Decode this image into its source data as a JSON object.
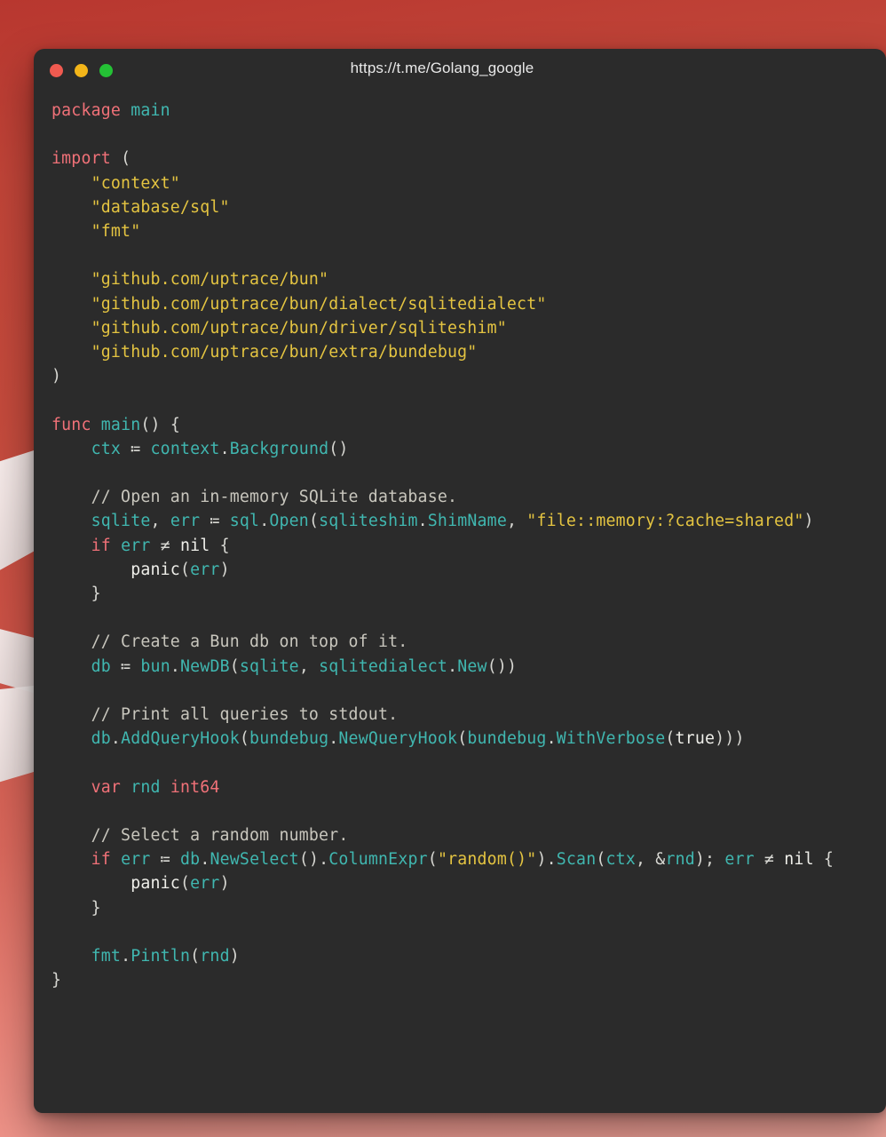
{
  "window": {
    "title": "https://t.me/Golang_google",
    "traffic_lights": [
      {
        "name": "close",
        "color": "#f05a50"
      },
      {
        "name": "minimize",
        "color": "#f3b519"
      },
      {
        "name": "maximize",
        "color": "#24c135"
      }
    ],
    "background_color": "#2b2b2b"
  },
  "backdrop": {
    "gradient_from": "#b8372f",
    "gradient_to": "#f3a79d"
  },
  "theme": {
    "keyword": "#f07178",
    "identifier": "#40b7b0",
    "string": "#e4c441",
    "comment": "#c8c6bd",
    "plain": "#d7d7d2"
  },
  "code": {
    "language": "go",
    "lines": [
      {
        "id": "l1",
        "text": "package main"
      },
      {
        "id": "l2",
        "text": ""
      },
      {
        "id": "l3",
        "text": "import ("
      },
      {
        "id": "l4",
        "text": "    \"context\""
      },
      {
        "id": "l5",
        "text": "    \"database/sql\""
      },
      {
        "id": "l6",
        "text": "    \"fmt\""
      },
      {
        "id": "l7",
        "text": ""
      },
      {
        "id": "l8",
        "text": "    \"github.com/uptrace/bun\""
      },
      {
        "id": "l9",
        "text": "    \"github.com/uptrace/bun/dialect/sqlitedialect\""
      },
      {
        "id": "l10",
        "text": "    \"github.com/uptrace/bun/driver/sqliteshim\""
      },
      {
        "id": "l11",
        "text": "    \"github.com/uptrace/bun/extra/bundebug\""
      },
      {
        "id": "l12",
        "text": ")"
      },
      {
        "id": "l13",
        "text": ""
      },
      {
        "id": "l14",
        "text": "func main() {"
      },
      {
        "id": "l15",
        "text": "    ctx := context.Background()"
      },
      {
        "id": "l16",
        "text": ""
      },
      {
        "id": "l17",
        "text": "    // Open an in-memory SQLite database."
      },
      {
        "id": "l18",
        "text": "    sqlite, err := sql.Open(sqliteshim.ShimName, \"file::memory:?cache=shared\")"
      },
      {
        "id": "l19",
        "text": "    if err != nil {"
      },
      {
        "id": "l20",
        "text": "        panic(err)"
      },
      {
        "id": "l21",
        "text": "    }"
      },
      {
        "id": "l22",
        "text": ""
      },
      {
        "id": "l23",
        "text": "    // Create a Bun db on top of it."
      },
      {
        "id": "l24",
        "text": "    db := bun.NewDB(sqlite, sqlitedialect.New())"
      },
      {
        "id": "l25",
        "text": ""
      },
      {
        "id": "l26",
        "text": "    // Print all queries to stdout."
      },
      {
        "id": "l27",
        "text": "    db.AddQueryHook(bundebug.NewQueryHook(bundebug.WithVerbose(true)))"
      },
      {
        "id": "l28",
        "text": ""
      },
      {
        "id": "l29",
        "text": "    var rnd int64"
      },
      {
        "id": "l30",
        "text": ""
      },
      {
        "id": "l31",
        "text": "    // Select a random number."
      },
      {
        "id": "l32",
        "text": "    if err := db.NewSelect().ColumnExpr(\"random()\").Scan(ctx, &rnd); err != nil {"
      },
      {
        "id": "l33",
        "text": "        panic(err)"
      },
      {
        "id": "l34",
        "text": "    }"
      },
      {
        "id": "l35",
        "text": ""
      },
      {
        "id": "l36",
        "text": "    fmt.Pintln(rnd)"
      },
      {
        "id": "l37",
        "text": "}"
      }
    ]
  }
}
